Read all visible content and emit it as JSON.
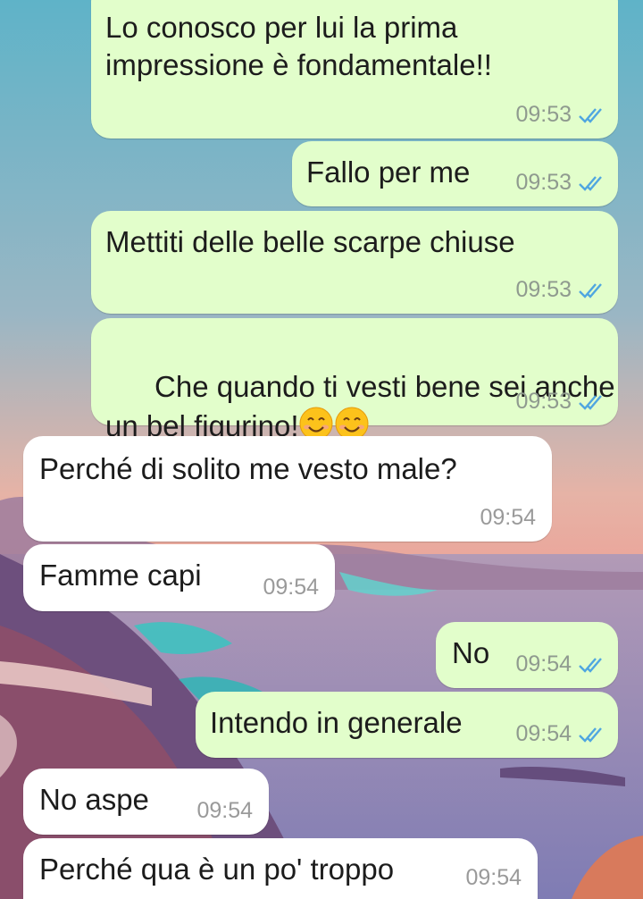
{
  "colors": {
    "outgoing_bubble": "#e2fecb",
    "incoming_bubble": "#ffffff",
    "read_ticks": "#4fa6e0"
  },
  "messages": [
    {
      "direction": "out",
      "text": "Lo conosco per lui la prima\nimpressione è fondamentale!!",
      "time": "09:53",
      "status": "read"
    },
    {
      "direction": "out",
      "text": "Fallo per me",
      "time": "09:53",
      "status": "read"
    },
    {
      "direction": "out",
      "text": "Mettiti delle belle scarpe chiuse",
      "time": "09:53",
      "status": "read"
    },
    {
      "direction": "out",
      "text_line1": "Che quando ti vesti bene sei anche",
      "text_line2": "un bel figurino!",
      "emojis": [
        "smiling-face-icon",
        "smiling-face-icon"
      ],
      "time": "09:53",
      "status": "read"
    },
    {
      "direction": "in",
      "text": "Perché di solito me vesto male?",
      "time": "09:54"
    },
    {
      "direction": "in",
      "text": "Famme capi",
      "time": "09:54"
    },
    {
      "direction": "out",
      "text": "No",
      "time": "09:54",
      "status": "read"
    },
    {
      "direction": "out",
      "text": "Intendo in generale",
      "time": "09:54",
      "status": "read"
    },
    {
      "direction": "in",
      "text": "No aspe",
      "time": "09:54"
    },
    {
      "direction": "in",
      "text": "Perché qua è un po' troppo",
      "time": "09:54"
    }
  ]
}
